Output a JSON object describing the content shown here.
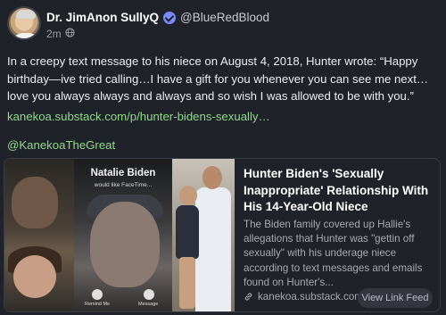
{
  "post": {
    "author_name": "Dr. JimAnon SullyQ",
    "author_handle": "@BlueRedBlood",
    "time": "2m",
    "visibility_icon": "globe-icon",
    "body": "In a creepy text message to his niece on August 4, 2018, Hunter wrote: “Happy birthday—ive tried calling…I have a gift for you whenever you can see me next…love you always always and always and so wish I was allowed to be with you.”",
    "link": "kanekoa.substack.com/p/hunter-bidens-sexually…",
    "mention": "@KanekoaTheGreat"
  },
  "card": {
    "image_caller_name": "Natalie Biden",
    "image_caller_sub": "would like FaceTime...",
    "image_btn_left": "Remind Me",
    "image_btn_right": "Message",
    "title": "Hunter Biden's 'Sexually Inappropriate' Relationship With His 14-Year-Old Niece",
    "description": "The Biden family covered up Hallie's allegations that Hunter was \"gettin off sexually\" with his underage niece according to text messages and emails found on Hunter's...",
    "domain": "kanekoa.substack.com",
    "button_label": "View Link Feed"
  },
  "colors": {
    "background": "#20222a",
    "link": "#8fd98b",
    "verified": "#7a8bff"
  }
}
